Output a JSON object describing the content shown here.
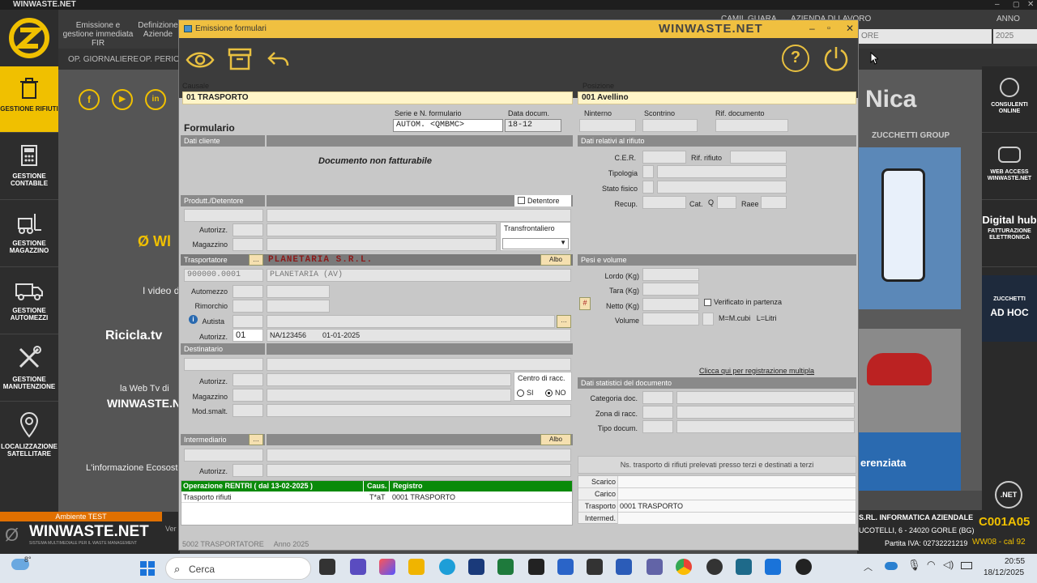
{
  "app": {
    "title": "WINWASTE.NET"
  },
  "background": {
    "menu": [
      "Emissione e gestione immediata FIR",
      "Definizione Aziende"
    ],
    "submenu": [
      "OP. GIORNALIERE",
      "OP. PERIODICHE"
    ],
    "top_right": {
      "user": "CAMIL GUARA",
      "company": "AZIENDA DI LAVORO",
      "year_label": "ANNO",
      "company_value": "ORE",
      "year_value": "2025"
    },
    "center_texts": [
      "I video d",
      "Ricicla.tv",
      "la Web Tv di",
      "WINWASTE.NET",
      "L'informazione Ecososte"
    ],
    "right_texts": [
      "Nica",
      "ZUCCHETTI GROUP",
      "erenziata"
    ]
  },
  "sidebar": {
    "items": [
      {
        "label": "GESTIONE RIFIUTI",
        "icon": "trash-bin-icon"
      },
      {
        "label": "GESTIONE CONTABILE",
        "icon": "calculator-icon"
      },
      {
        "label": "GESTIONE MAGAZZINO",
        "icon": "forklift-icon"
      },
      {
        "label": "GESTIONE AUTOMEZZI",
        "icon": "truck-icon"
      },
      {
        "label": "GESTIONE MANUTENZIONE",
        "icon": "tools-icon"
      },
      {
        "label": "LOCALIZZAZIONE SATELLITARE",
        "icon": "location-pin-icon"
      }
    ]
  },
  "rightbar": {
    "items": [
      "CONSULENTI ONLINE",
      "WEB ACCESS WINWASTE.NET",
      "Digital hub",
      "FATTURAZIONE ELETTRONICA",
      "ZUCCHETTI",
      "AD HOC",
      ".NET"
    ]
  },
  "bottom_left": {
    "env": "Ambiente TEST",
    "brand": "WINWASTE.NET",
    "tagline": "SISTEMA MULTIMEDIALE PER IL WASTE MANAGEMENT",
    "ver": "Ver"
  },
  "bottom_right": {
    "company": "S.RL. INFORMATICA AZIENDALE",
    "address": "UCOTELLI, 6 - 24020 GORLE (BG)",
    "piva": "Partita IVA: 02732221219",
    "code": "C001A05",
    "build": "WW08 - cal 92"
  },
  "window": {
    "title": "Emissione formulari",
    "brand": "WINWASTE.NET",
    "causale_label": "Causale",
    "causale_value": "01  TRASPORTO",
    "posizione_label": "Posizione",
    "posizione_value": "001 Avellino",
    "formulario_label": "Formulario",
    "serie_label": "Serie e N. formulario",
    "serie_value": "AUTOM. <QMBMC>",
    "data_label": "Data docum.",
    "data_value": "18-12",
    "ninterno_label": "Ninterno",
    "scontrino_label": "Scontrino",
    "rifdoc_label": "Rif. documento",
    "dati_cliente": "Dati cliente",
    "non_fatturabile": "Documento non fatturabile",
    "produttore": "Produtt./Detentore",
    "detentore": "Detentore",
    "autorizz": "Autorizz.",
    "magazzino": "Magazzino",
    "transfrontaliero": "Transfrontaliero",
    "trasportatore": "Trasportatore",
    "trasp_name": "PLANETARIA S.R.L.",
    "trasp_code": "900000.0001",
    "trasp_city": "PLANETARIA (AV)",
    "albo": "Albo",
    "automezzo": "Automezzo",
    "rimorchio": "Rimorchio",
    "autista": "Autista",
    "autorizz_code": "01",
    "autorizz_num": "NA/123456",
    "autorizz_date": "01-01-2025",
    "destinatario": "Destinatario",
    "modsmalt": "Mod.smalt.",
    "centro": "Centro di racc.",
    "si": "SI",
    "no": "NO",
    "intermediario": "Intermediario",
    "ops_header": [
      "Operazione RENTRI  ( dal 13-02-2025 )",
      "Caus.",
      "Registro"
    ],
    "ops_row": [
      "Trasporto rifiuti",
      "T*aT",
      "0001 TRASPORTO"
    ],
    "footer": "5002 TRASPORTATORE     Anno 2025",
    "dati_rifiuto": "Dati relativi al rifiuto",
    "cer": "C.E.R.",
    "rifrifiuto": "Rif. rifiuto",
    "tipologia": "Tipologia",
    "stato": "Stato fisico",
    "recup": "Recup.",
    "cat": "Cat.",
    "q": "Q",
    "raee": "Raee",
    "pesi": "Pesi e volume",
    "lordo": "Lordo (Kg)",
    "tara": "Tara (Kg)",
    "netto": "Netto (Kg)",
    "volume": "Volume",
    "hash": "#",
    "verificato": "Verificato in partenza",
    "mcubi": "M=M.cubi   L=Litri",
    "multipla": "Clicca qui per registrazione multipla",
    "stat": "Dati statistici del documento",
    "categoria": "Categoria doc.",
    "zona": "Zona di racc.",
    "tipodoc": "Tipo docum.",
    "ns_trasporto": "Ns. trasporto di rifiuti prelevati presso terzi e destinati a terzi",
    "reg_rows": [
      {
        "k": "Scarico",
        "v": ""
      },
      {
        "k": "Carico",
        "v": ""
      },
      {
        "k": "Trasporto",
        "v": "0001 TRASPORTO"
      },
      {
        "k": "Intermed.",
        "v": ""
      }
    ]
  },
  "taskbar": {
    "search": "Cerca",
    "time": "20:55",
    "date": "18/12/2025",
    "temp": "8°"
  },
  "colors": {
    "accent": "#f0c000",
    "rentri_green": "#0a8a0a",
    "field_yellow": "#fff5c8",
    "trasp_red": "#8b1a1a"
  }
}
